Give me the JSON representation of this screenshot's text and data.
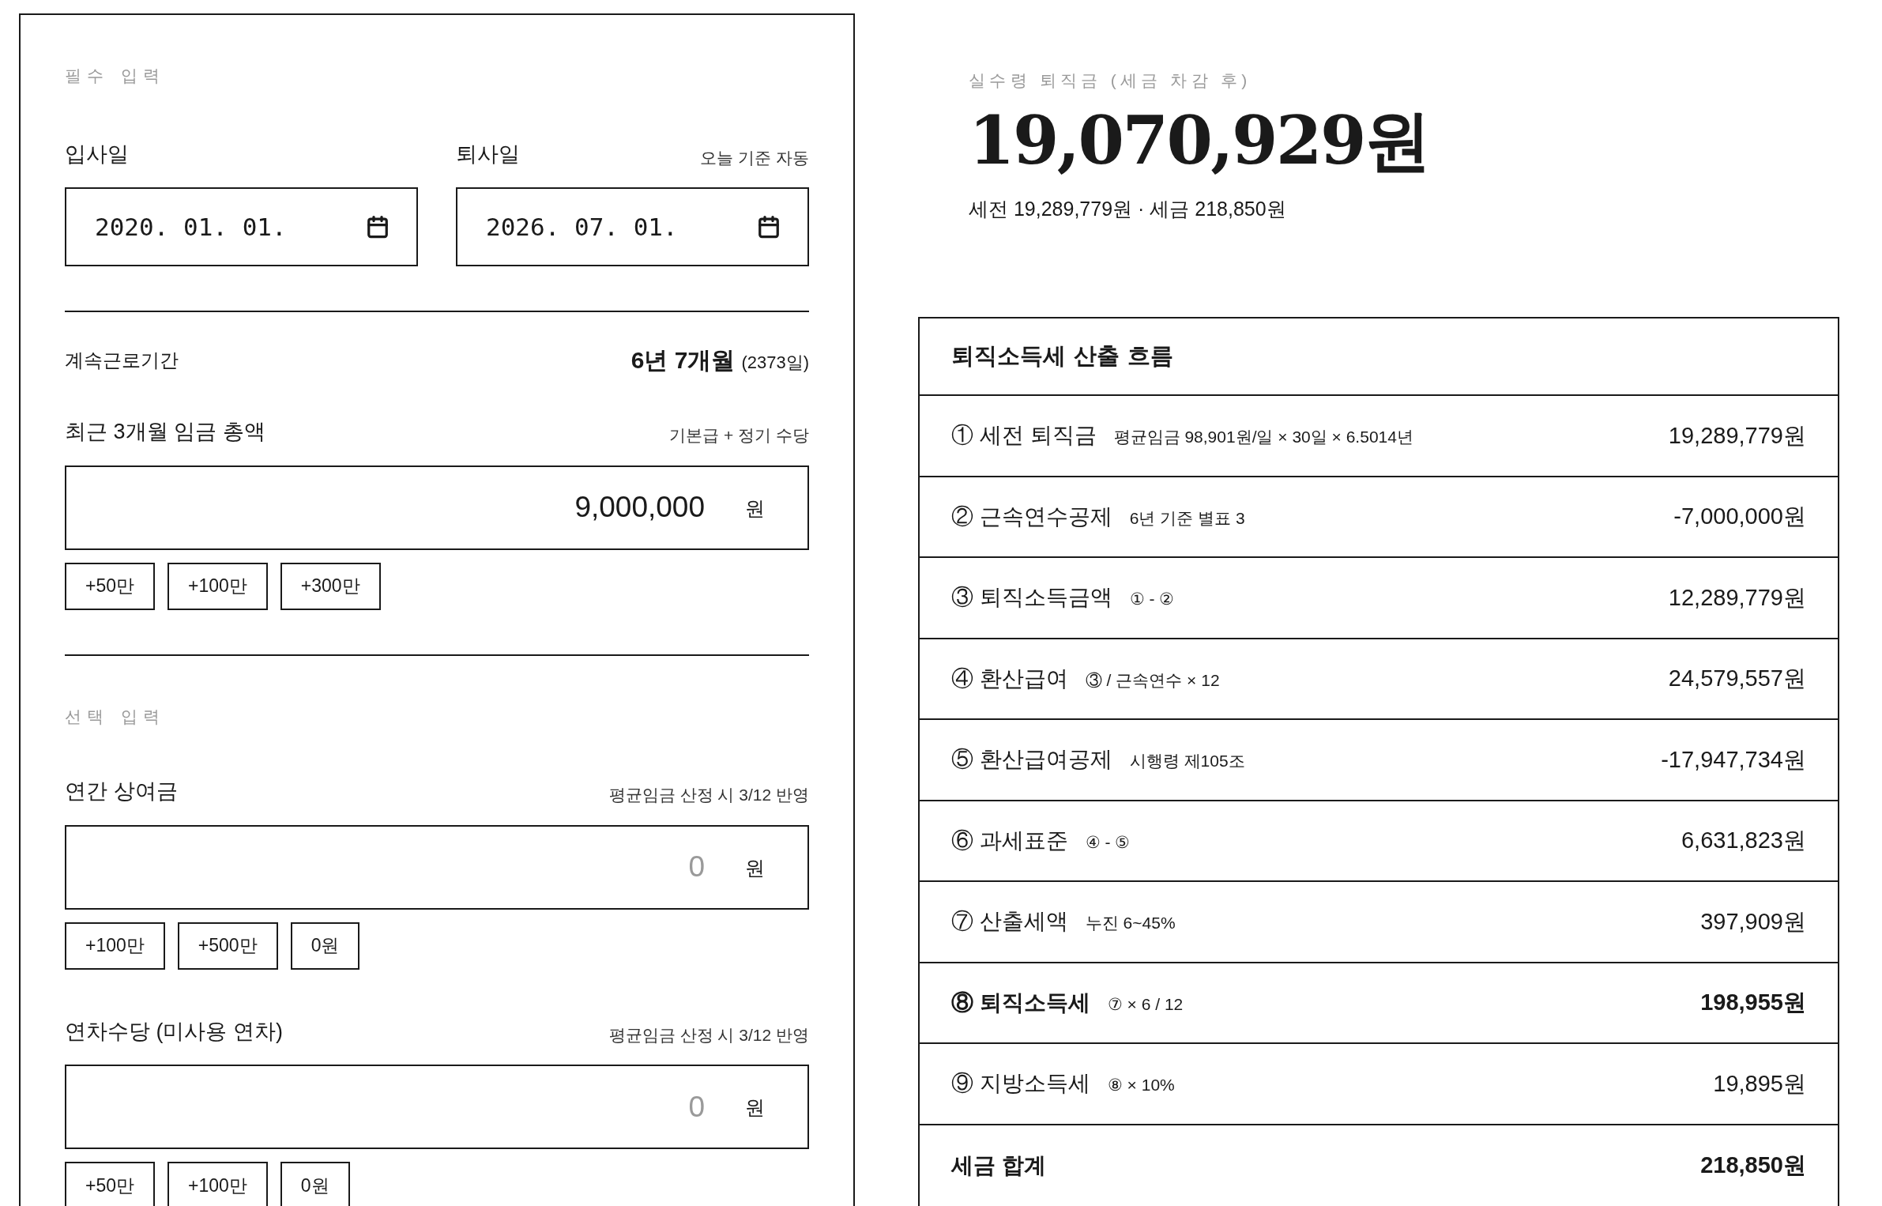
{
  "required_section": {
    "heading": "필수 입력",
    "dates": [
      {
        "label": "입사일",
        "value": "2020. 01. 01."
      },
      {
        "label": "퇴사일",
        "hint": "오늘 기준 자동",
        "value": "2026. 07. 01."
      }
    ],
    "tenure": {
      "label": "계속근로기간",
      "value": "6년 7개월",
      "days": "(2373일)"
    },
    "wage": {
      "label": "최근 3개월 임금 총액",
      "hint": "기본급 + 정기 수당",
      "value": "9,000,000",
      "unit": "원",
      "presets": [
        "+50만",
        "+100만",
        "+300만"
      ]
    }
  },
  "optional_section": {
    "heading": "선택 입력",
    "fields": [
      {
        "label": "연간 상여금",
        "hint": "평균임금 산정 시 3/12 반영",
        "placeholder": "0",
        "unit": "원",
        "presets": [
          "+100만",
          "+500만",
          "0원"
        ]
      },
      {
        "label": "연차수당 (미사용 연차)",
        "hint": "평균임금 산정 시 3/12 반영",
        "placeholder": "0",
        "unit": "원",
        "presets": [
          "+50만",
          "+100만",
          "0원"
        ]
      }
    ]
  },
  "result": {
    "caption": "실수령 퇴직금 (세금 차감 후)",
    "amount": "19,070,929원",
    "summary": "세전 19,289,779원 · 세금 218,850원"
  },
  "breakdown": {
    "title": "퇴직소득세 산출 흐름",
    "rows": [
      {
        "label": "① 세전 퇴직금",
        "note": "평균임금 98,901원/일 × 30일 × 6.5014년",
        "value": "19,289,779원",
        "bold": false
      },
      {
        "label": "② 근속연수공제",
        "note": "6년 기준 별표 3",
        "value": "-7,000,000원",
        "bold": false
      },
      {
        "label": "③ 퇴직소득금액",
        "note": "① - ②",
        "value": "12,289,779원",
        "bold": false
      },
      {
        "label": "④ 환산급여",
        "note": "③ / 근속연수 × 12",
        "value": "24,579,557원",
        "bold": false
      },
      {
        "label": "⑤ 환산급여공제",
        "note": "시행령 제105조",
        "value": "-17,947,734원",
        "bold": false
      },
      {
        "label": "⑥ 과세표준",
        "note": "④ - ⑤",
        "value": "6,631,823원",
        "bold": false
      },
      {
        "label": "⑦ 산출세액",
        "note": "누진 6~45%",
        "value": "397,909원",
        "bold": false
      },
      {
        "label": "⑧ 퇴직소득세",
        "note": "⑦ × 6 / 12",
        "value": "198,955원",
        "bold": true
      },
      {
        "label": "⑨ 지방소득세",
        "note": "⑧ × 10%",
        "value": "19,895원",
        "bold": false
      }
    ],
    "total": {
      "label": "세금 합계",
      "value": "218,850원"
    }
  }
}
